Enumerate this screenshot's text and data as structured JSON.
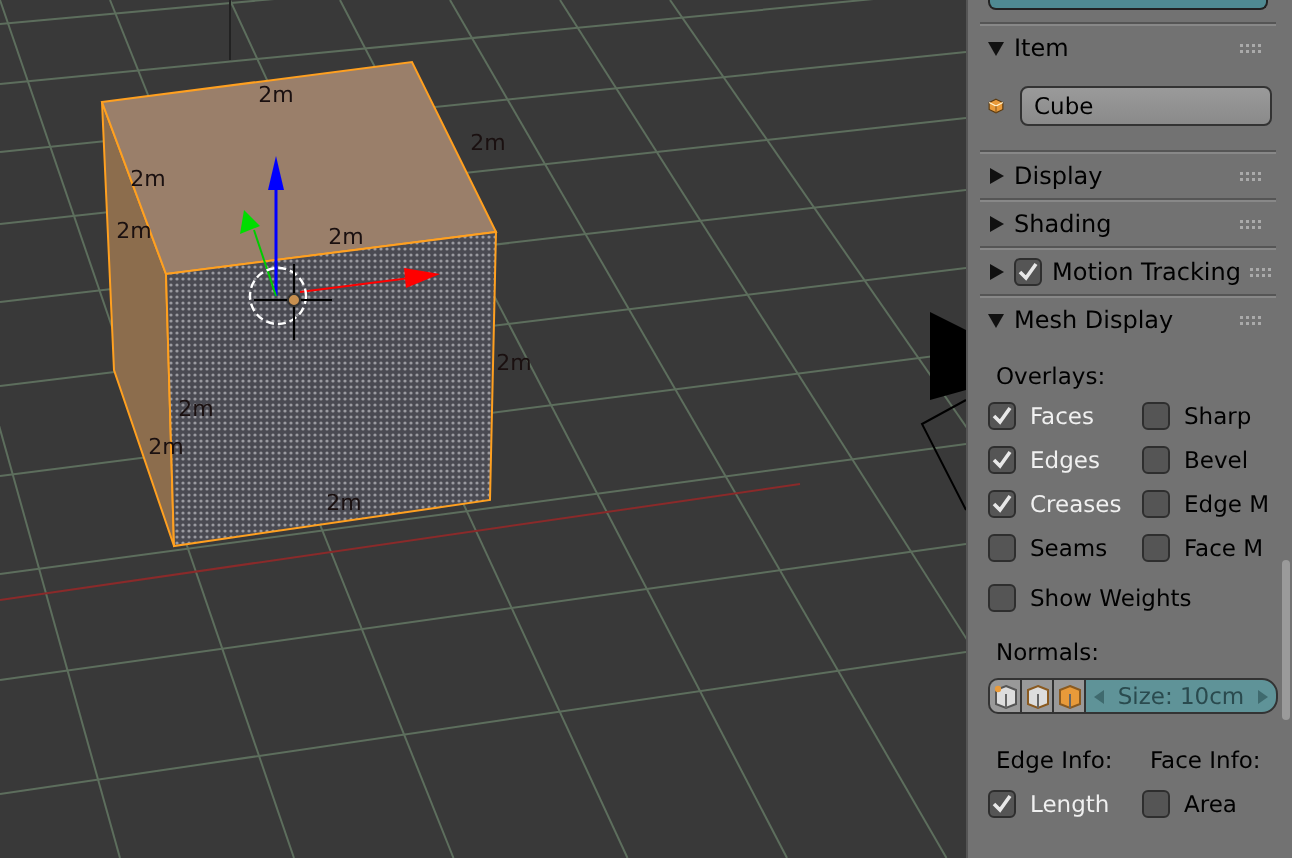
{
  "viewport": {
    "edge_labels": [
      "2m",
      "2m",
      "2m",
      "2m",
      "2m",
      "2m",
      "2m",
      "2m",
      "2m"
    ]
  },
  "sections": [
    {
      "kind": "item",
      "title": "Item",
      "expanded": true,
      "name_field": "Cube"
    },
    {
      "kind": "plain",
      "title": "Display",
      "expanded": false
    },
    {
      "kind": "plain",
      "title": "Shading",
      "expanded": false
    },
    {
      "kind": "toggle",
      "title": "Motion Tracking",
      "expanded": false,
      "checked": true
    },
    {
      "kind": "mesh",
      "title": "Mesh Display",
      "expanded": true,
      "overlays_label": "Overlays:",
      "overlays": [
        {
          "label": "Faces",
          "checked": true
        },
        {
          "label": "Sharp",
          "checked": false
        },
        {
          "label": "Edges",
          "checked": true
        },
        {
          "label": "Bevel",
          "checked": false
        },
        {
          "label": "Creases",
          "checked": true
        },
        {
          "label": "Edge M",
          "checked": false
        },
        {
          "label": "Seams",
          "checked": false
        },
        {
          "label": "Face M",
          "checked": false
        }
      ],
      "show_weights": {
        "label": "Show Weights",
        "checked": false
      },
      "normals_label": "Normals:",
      "normals_size": "Size: 10cm",
      "edge_info_label": "Edge Info:",
      "face_info_label": "Face Info:",
      "info": [
        {
          "label": "Length",
          "checked": true
        },
        {
          "label": "Area",
          "checked": false
        }
      ]
    }
  ]
}
